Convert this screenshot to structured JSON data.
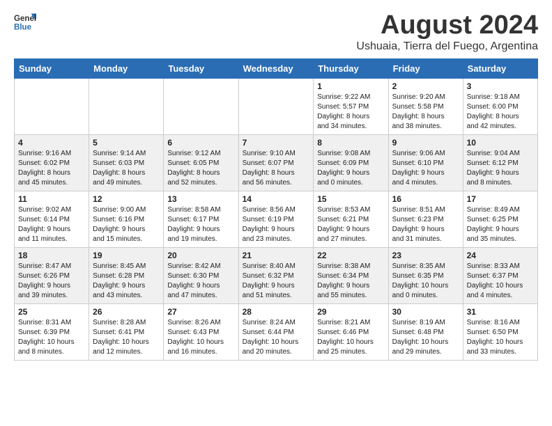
{
  "header": {
    "logo_general": "General",
    "logo_blue": "Blue",
    "month_title": "August 2024",
    "subtitle": "Ushuaia, Tierra del Fuego, Argentina"
  },
  "weekdays": [
    "Sunday",
    "Monday",
    "Tuesday",
    "Wednesday",
    "Thursday",
    "Friday",
    "Saturday"
  ],
  "weeks": [
    [
      {
        "day": "",
        "info": ""
      },
      {
        "day": "",
        "info": ""
      },
      {
        "day": "",
        "info": ""
      },
      {
        "day": "",
        "info": ""
      },
      {
        "day": "1",
        "info": "Sunrise: 9:22 AM\nSunset: 5:57 PM\nDaylight: 8 hours\nand 34 minutes."
      },
      {
        "day": "2",
        "info": "Sunrise: 9:20 AM\nSunset: 5:58 PM\nDaylight: 8 hours\nand 38 minutes."
      },
      {
        "day": "3",
        "info": "Sunrise: 9:18 AM\nSunset: 6:00 PM\nDaylight: 8 hours\nand 42 minutes."
      }
    ],
    [
      {
        "day": "4",
        "info": "Sunrise: 9:16 AM\nSunset: 6:02 PM\nDaylight: 8 hours\nand 45 minutes."
      },
      {
        "day": "5",
        "info": "Sunrise: 9:14 AM\nSunset: 6:03 PM\nDaylight: 8 hours\nand 49 minutes."
      },
      {
        "day": "6",
        "info": "Sunrise: 9:12 AM\nSunset: 6:05 PM\nDaylight: 8 hours\nand 52 minutes."
      },
      {
        "day": "7",
        "info": "Sunrise: 9:10 AM\nSunset: 6:07 PM\nDaylight: 8 hours\nand 56 minutes."
      },
      {
        "day": "8",
        "info": "Sunrise: 9:08 AM\nSunset: 6:09 PM\nDaylight: 9 hours\nand 0 minutes."
      },
      {
        "day": "9",
        "info": "Sunrise: 9:06 AM\nSunset: 6:10 PM\nDaylight: 9 hours\nand 4 minutes."
      },
      {
        "day": "10",
        "info": "Sunrise: 9:04 AM\nSunset: 6:12 PM\nDaylight: 9 hours\nand 8 minutes."
      }
    ],
    [
      {
        "day": "11",
        "info": "Sunrise: 9:02 AM\nSunset: 6:14 PM\nDaylight: 9 hours\nand 11 minutes."
      },
      {
        "day": "12",
        "info": "Sunrise: 9:00 AM\nSunset: 6:16 PM\nDaylight: 9 hours\nand 15 minutes."
      },
      {
        "day": "13",
        "info": "Sunrise: 8:58 AM\nSunset: 6:17 PM\nDaylight: 9 hours\nand 19 minutes."
      },
      {
        "day": "14",
        "info": "Sunrise: 8:56 AM\nSunset: 6:19 PM\nDaylight: 9 hours\nand 23 minutes."
      },
      {
        "day": "15",
        "info": "Sunrise: 8:53 AM\nSunset: 6:21 PM\nDaylight: 9 hours\nand 27 minutes."
      },
      {
        "day": "16",
        "info": "Sunrise: 8:51 AM\nSunset: 6:23 PM\nDaylight: 9 hours\nand 31 minutes."
      },
      {
        "day": "17",
        "info": "Sunrise: 8:49 AM\nSunset: 6:25 PM\nDaylight: 9 hours\nand 35 minutes."
      }
    ],
    [
      {
        "day": "18",
        "info": "Sunrise: 8:47 AM\nSunset: 6:26 PM\nDaylight: 9 hours\nand 39 minutes."
      },
      {
        "day": "19",
        "info": "Sunrise: 8:45 AM\nSunset: 6:28 PM\nDaylight: 9 hours\nand 43 minutes."
      },
      {
        "day": "20",
        "info": "Sunrise: 8:42 AM\nSunset: 6:30 PM\nDaylight: 9 hours\nand 47 minutes."
      },
      {
        "day": "21",
        "info": "Sunrise: 8:40 AM\nSunset: 6:32 PM\nDaylight: 9 hours\nand 51 minutes."
      },
      {
        "day": "22",
        "info": "Sunrise: 8:38 AM\nSunset: 6:34 PM\nDaylight: 9 hours\nand 55 minutes."
      },
      {
        "day": "23",
        "info": "Sunrise: 8:35 AM\nSunset: 6:35 PM\nDaylight: 10 hours\nand 0 minutes."
      },
      {
        "day": "24",
        "info": "Sunrise: 8:33 AM\nSunset: 6:37 PM\nDaylight: 10 hours\nand 4 minutes."
      }
    ],
    [
      {
        "day": "25",
        "info": "Sunrise: 8:31 AM\nSunset: 6:39 PM\nDaylight: 10 hours\nand 8 minutes."
      },
      {
        "day": "26",
        "info": "Sunrise: 8:28 AM\nSunset: 6:41 PM\nDaylight: 10 hours\nand 12 minutes."
      },
      {
        "day": "27",
        "info": "Sunrise: 8:26 AM\nSunset: 6:43 PM\nDaylight: 10 hours\nand 16 minutes."
      },
      {
        "day": "28",
        "info": "Sunrise: 8:24 AM\nSunset: 6:44 PM\nDaylight: 10 hours\nand 20 minutes."
      },
      {
        "day": "29",
        "info": "Sunrise: 8:21 AM\nSunset: 6:46 PM\nDaylight: 10 hours\nand 25 minutes."
      },
      {
        "day": "30",
        "info": "Sunrise: 8:19 AM\nSunset: 6:48 PM\nDaylight: 10 hours\nand 29 minutes."
      },
      {
        "day": "31",
        "info": "Sunrise: 8:16 AM\nSunset: 6:50 PM\nDaylight: 10 hours\nand 33 minutes."
      }
    ]
  ]
}
